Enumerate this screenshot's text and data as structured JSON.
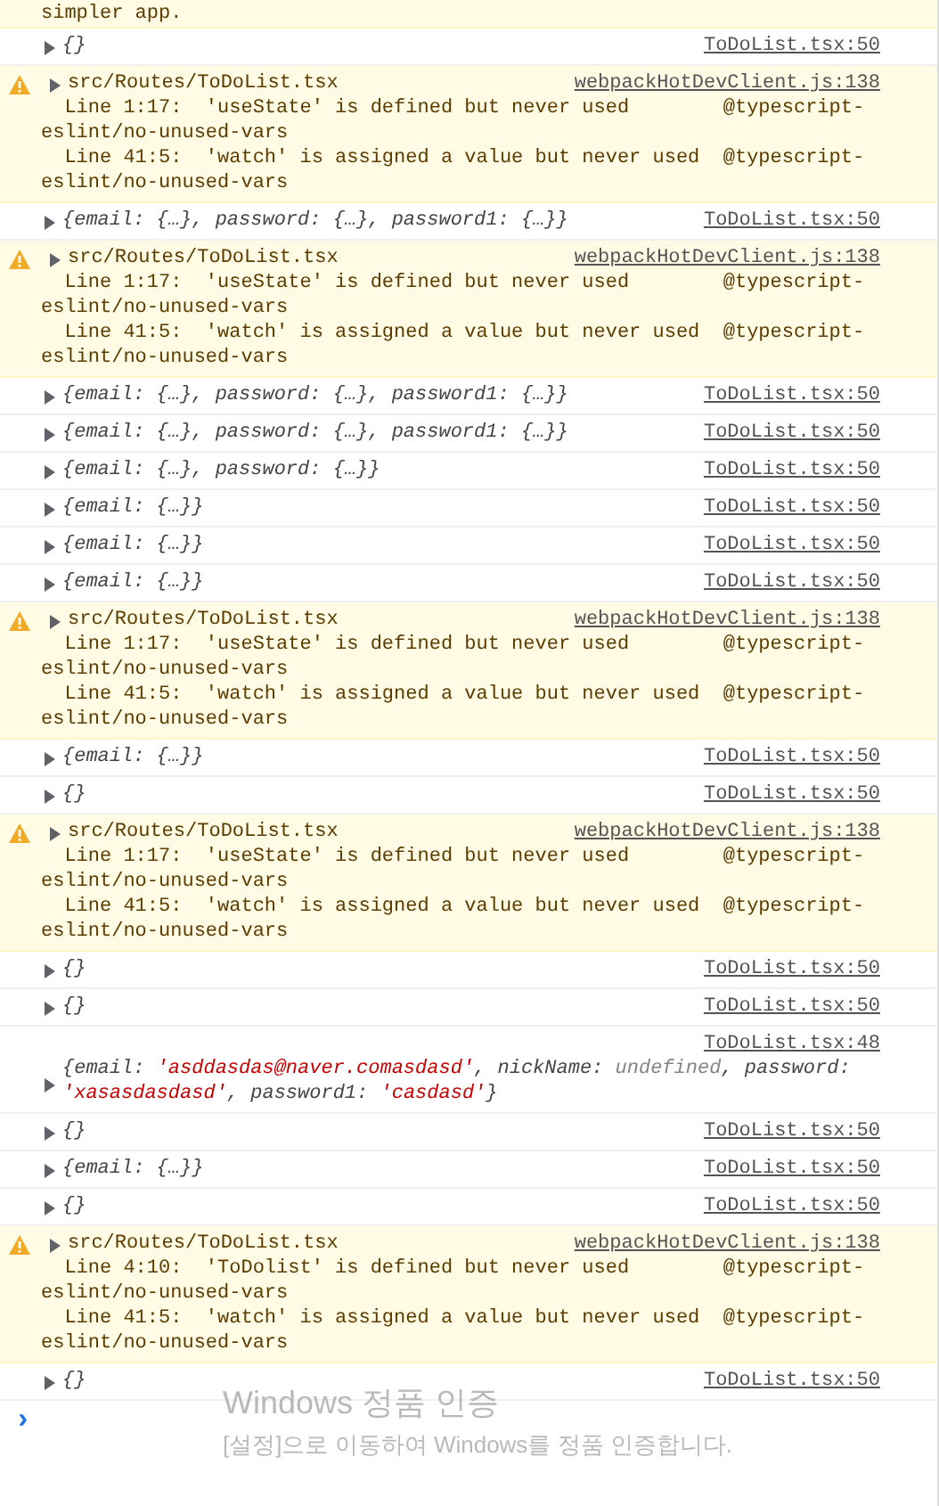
{
  "entries": [
    {
      "kind": "warning-tail",
      "text": "simpler app."
    },
    {
      "kind": "log",
      "value": "{}",
      "source": "ToDoList.tsx:50"
    },
    {
      "kind": "warning",
      "header": "src/Routes/ToDoList.tsx",
      "source": "webpackHotDevClient.js:138",
      "lines": [
        "  Line 1:17:  'useState' is defined but never used        @typescript-eslint/no-unused-vars",
        "  Line 41:5:  'watch' is assigned a value but never used  @typescript-eslint/no-unused-vars"
      ]
    },
    {
      "kind": "log",
      "value": "{email: {…}, password: {…}, password1: {…}}",
      "source": "ToDoList.tsx:50"
    },
    {
      "kind": "warning",
      "header": "src/Routes/ToDoList.tsx",
      "source": "webpackHotDevClient.js:138",
      "lines": [
        "  Line 1:17:  'useState' is defined but never used        @typescript-eslint/no-unused-vars",
        "  Line 41:5:  'watch' is assigned a value but never used  @typescript-eslint/no-unused-vars"
      ]
    },
    {
      "kind": "log",
      "value": "{email: {…}, password: {…}, password1: {…}}",
      "source": "ToDoList.tsx:50"
    },
    {
      "kind": "log",
      "value": "{email: {…}, password: {…}, password1: {…}}",
      "source": "ToDoList.tsx:50"
    },
    {
      "kind": "log",
      "value": "{email: {…}, password: {…}}",
      "source": "ToDoList.tsx:50"
    },
    {
      "kind": "log",
      "value": "{email: {…}}",
      "source": "ToDoList.tsx:50"
    },
    {
      "kind": "log",
      "value": "{email: {…}}",
      "source": "ToDoList.tsx:50"
    },
    {
      "kind": "log",
      "value": "{email: {…}}",
      "source": "ToDoList.tsx:50"
    },
    {
      "kind": "warning",
      "header": "src/Routes/ToDoList.tsx",
      "source": "webpackHotDevClient.js:138",
      "lines": [
        "  Line 1:17:  'useState' is defined but never used        @typescript-eslint/no-unused-vars",
        "  Line 41:5:  'watch' is assigned a value but never used  @typescript-eslint/no-unused-vars"
      ]
    },
    {
      "kind": "log",
      "value": "{email: {…}}",
      "source": "ToDoList.tsx:50"
    },
    {
      "kind": "log",
      "value": "{}",
      "source": "ToDoList.tsx:50"
    },
    {
      "kind": "warning",
      "header": "src/Routes/ToDoList.tsx",
      "source": "webpackHotDevClient.js:138",
      "lines": [
        "  Line 1:17:  'useState' is defined but never used        @typescript-eslint/no-unused-vars",
        "  Line 41:5:  'watch' is assigned a value but never used  @typescript-eslint/no-unused-vars"
      ]
    },
    {
      "kind": "log",
      "value": "{}",
      "source": "ToDoList.tsx:50"
    },
    {
      "kind": "log",
      "value": "{}",
      "source": "ToDoList.tsx:50"
    },
    {
      "kind": "object-log",
      "source": "ToDoList.tsx:48",
      "parts": [
        {
          "kind": "punct",
          "text": "{email: "
        },
        {
          "kind": "string",
          "text": "'asddasdas@naver.comasdasd'"
        },
        {
          "kind": "punct",
          "text": ", nickName: "
        },
        {
          "kind": "undefined",
          "text": "undefined"
        },
        {
          "kind": "punct",
          "text": ", password: "
        },
        {
          "kind": "string",
          "text": "'xasasdasdasd'"
        },
        {
          "kind": "punct",
          "text": ", password1: "
        },
        {
          "kind": "string",
          "text": "'casdasd'"
        },
        {
          "kind": "punct",
          "text": "}"
        }
      ]
    },
    {
      "kind": "log",
      "value": "{}",
      "source": "ToDoList.tsx:50"
    },
    {
      "kind": "log",
      "value": "{email: {…}}",
      "source": "ToDoList.tsx:50"
    },
    {
      "kind": "log",
      "value": "{}",
      "source": "ToDoList.tsx:50"
    },
    {
      "kind": "warning",
      "header": "src/Routes/ToDoList.tsx",
      "source": "webpackHotDevClient.js:138",
      "lines": [
        "  Line 4:10:  'ToDolist' is defined but never used        @typescript-eslint/no-unused-vars",
        "  Line 41:5:  'watch' is assigned a value but never used  @typescript-eslint/no-unused-vars"
      ]
    },
    {
      "kind": "log",
      "value": "{}",
      "source": "ToDoList.tsx:50"
    }
  ],
  "prompt": "›",
  "os_watermark": {
    "title": "Windows 정품 인증",
    "subtitle": "[설정]으로 이동하여 Windows를 정품 인증합니다."
  }
}
